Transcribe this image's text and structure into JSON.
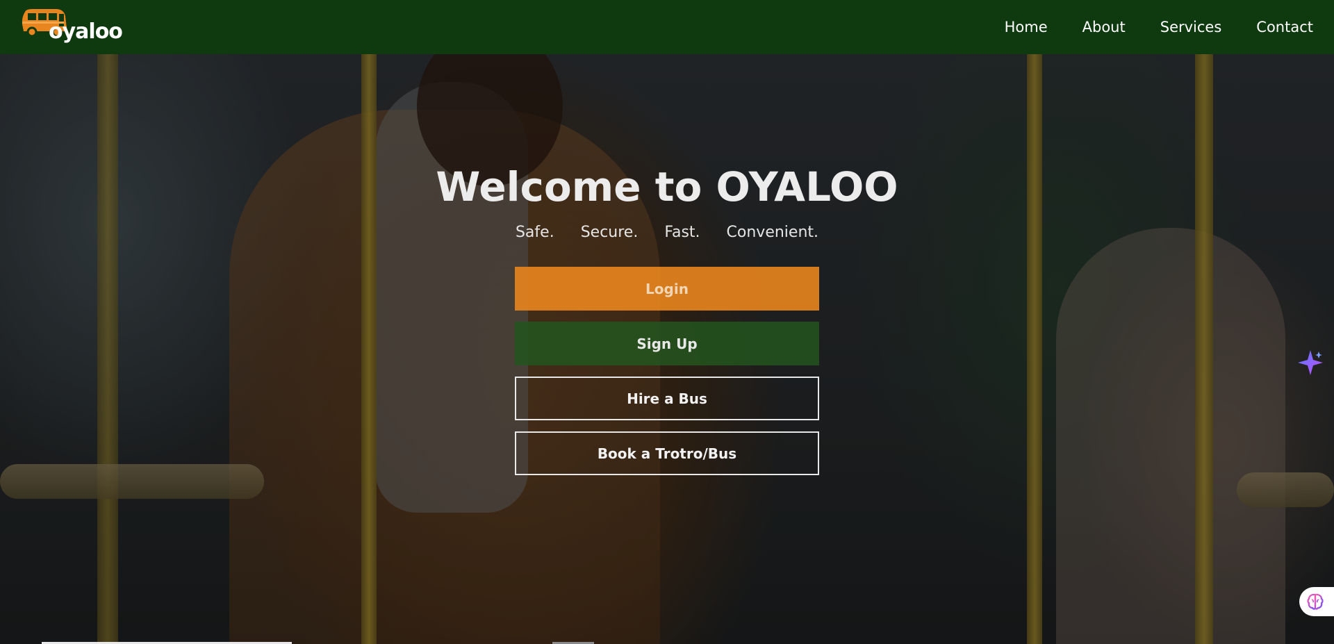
{
  "navbar": {
    "logo_text": "oyaloo",
    "links": [
      {
        "label": "Home"
      },
      {
        "label": "About"
      },
      {
        "label": "Services"
      },
      {
        "label": "Contact"
      }
    ]
  },
  "hero": {
    "title": "Welcome to OYALOO",
    "taglines": [
      "Safe.",
      "Secure.",
      "Fast.",
      "Convenient."
    ],
    "buttons": {
      "login": "Login",
      "signup": "Sign Up",
      "hire": "Hire a Bus",
      "book": "Book a Trotro/Bus"
    }
  },
  "colors": {
    "navbar_bg": "#0f3a0f",
    "accent_orange": "#e9851e",
    "accent_green": "#23551e"
  },
  "icons": {
    "logo": "bus-icon",
    "floating_1": "sparkle-icon",
    "floating_2": "brain-icon"
  }
}
